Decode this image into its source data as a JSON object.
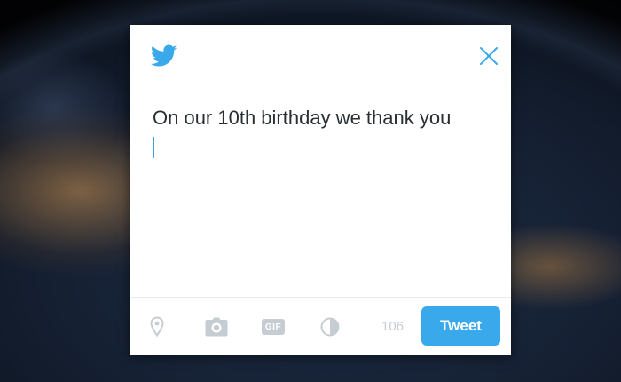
{
  "composer": {
    "text": "On our 10th birthday we thank you",
    "char_count": "106"
  },
  "actions": {
    "tweet_label": "Tweet",
    "gif_label": "GIF"
  },
  "icons": {
    "logo": "twitter-bird-icon",
    "close": "close-icon",
    "location": "location-pin-icon",
    "camera": "camera-icon",
    "gif": "gif-icon",
    "poll": "poll-icon"
  },
  "colors": {
    "accent": "#3aa9ec",
    "icon_gray": "#c5cdd3",
    "text": "#292f33"
  }
}
